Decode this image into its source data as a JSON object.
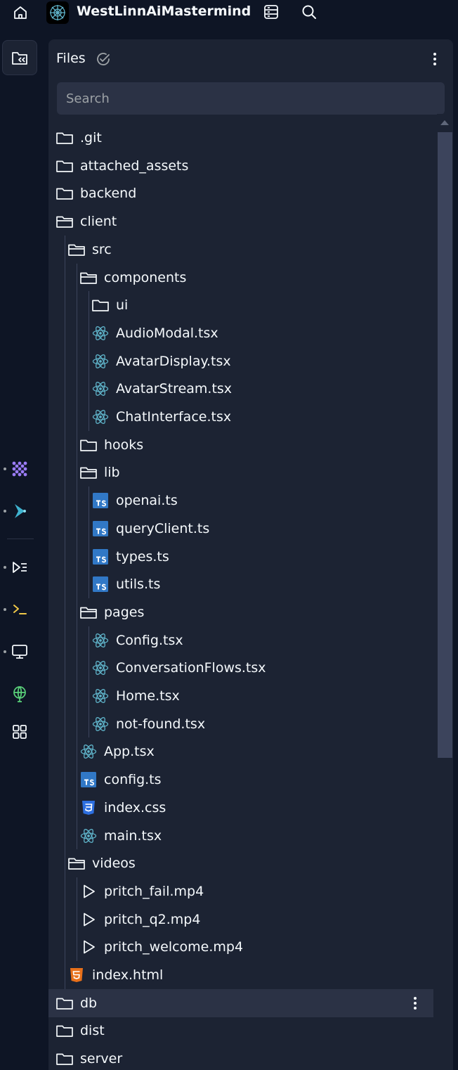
{
  "app": {
    "title": "WestLinnAiMastermind"
  },
  "panel": {
    "title": "Files",
    "search_placeholder": "Search"
  },
  "files": [
    {
      "label": ".git",
      "icon": "folder-icon",
      "depth": 0
    },
    {
      "label": "attached_assets",
      "icon": "folder-icon",
      "depth": 0
    },
    {
      "label": "backend",
      "icon": "folder-icon",
      "depth": 0
    },
    {
      "label": "client",
      "icon": "folder-open-icon",
      "depth": 0
    },
    {
      "label": "src",
      "icon": "folder-open-icon",
      "depth": 1
    },
    {
      "label": "components",
      "icon": "folder-open-icon",
      "depth": 2
    },
    {
      "label": "ui",
      "icon": "folder-icon",
      "depth": 3
    },
    {
      "label": "AudioModal.tsx",
      "icon": "react-icon",
      "depth": 3
    },
    {
      "label": "AvatarDisplay.tsx",
      "icon": "react-icon",
      "depth": 3
    },
    {
      "label": "AvatarStream.tsx",
      "icon": "react-icon",
      "depth": 3
    },
    {
      "label": "ChatInterface.tsx",
      "icon": "react-icon",
      "depth": 3
    },
    {
      "label": "hooks",
      "icon": "folder-icon",
      "depth": 2
    },
    {
      "label": "lib",
      "icon": "folder-open-icon",
      "depth": 2
    },
    {
      "label": "openai.ts",
      "icon": "typescript-icon",
      "depth": 3
    },
    {
      "label": "queryClient.ts",
      "icon": "typescript-icon",
      "depth": 3
    },
    {
      "label": "types.ts",
      "icon": "typescript-icon",
      "depth": 3
    },
    {
      "label": "utils.ts",
      "icon": "typescript-icon",
      "depth": 3
    },
    {
      "label": "pages",
      "icon": "folder-open-icon",
      "depth": 2
    },
    {
      "label": "Config.tsx",
      "icon": "react-icon",
      "depth": 3
    },
    {
      "label": "ConversationFlows.tsx",
      "icon": "react-icon",
      "depth": 3
    },
    {
      "label": "Home.tsx",
      "icon": "react-icon",
      "depth": 3
    },
    {
      "label": "not-found.tsx",
      "icon": "react-icon",
      "depth": 3
    },
    {
      "label": "App.tsx",
      "icon": "react-icon",
      "depth": 2
    },
    {
      "label": "config.ts",
      "icon": "typescript-icon",
      "depth": 2
    },
    {
      "label": "index.css",
      "icon": "css-icon",
      "depth": 2
    },
    {
      "label": "main.tsx",
      "icon": "react-icon",
      "depth": 2
    },
    {
      "label": "videos",
      "icon": "folder-open-icon",
      "depth": 1
    },
    {
      "label": "pritch_fail.mp4",
      "icon": "play-icon",
      "depth": 2
    },
    {
      "label": "pritch_q2.mp4",
      "icon": "play-icon",
      "depth": 2
    },
    {
      "label": "pritch_welcome.mp4",
      "icon": "play-icon",
      "depth": 2
    },
    {
      "label": "index.html",
      "icon": "html-icon",
      "depth": 1
    },
    {
      "label": "db",
      "icon": "folder-icon",
      "depth": 0,
      "hovered": true
    },
    {
      "label": "dist",
      "icon": "folder-icon",
      "depth": 0
    },
    {
      "label": "server",
      "icon": "folder-icon",
      "depth": 0
    }
  ],
  "colors": {
    "background": "#0e1525",
    "panel": "#1c2333",
    "react": "#5fb3c9",
    "typescript": "#3178c6",
    "css": "#2d6fe0",
    "html": "#e8701a"
  }
}
